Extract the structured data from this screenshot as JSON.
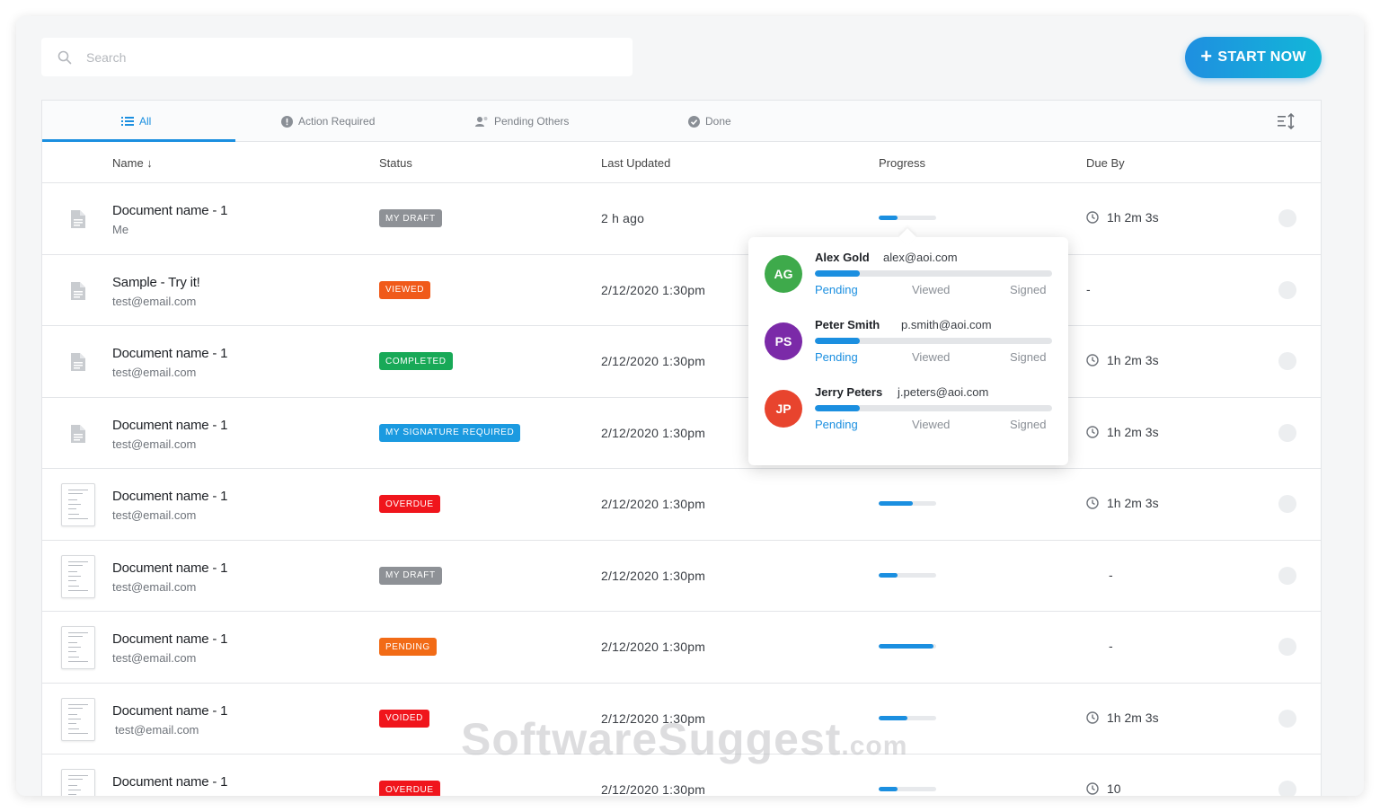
{
  "search": {
    "placeholder": "Search"
  },
  "start_button": {
    "label": "START NOW"
  },
  "tabs": [
    {
      "label": "All",
      "icon": "list-icon"
    },
    {
      "label": "Action Required",
      "icon": "alert-icon"
    },
    {
      "label": "Pending Others",
      "icon": "user-pending-icon"
    },
    {
      "label": "Done",
      "icon": "check-circle-icon"
    }
  ],
  "columns": {
    "name": "Name ↓",
    "status": "Status",
    "last_updated": "Last Updated",
    "progress": "Progress",
    "due_by": "Due By"
  },
  "rows": [
    {
      "title": "Document name - 1",
      "owner": "Me",
      "status": "MY DRAFT",
      "status_color": "#8e9196",
      "updated": "2 h ago",
      "progress": 0.33,
      "due": "1h 2m 3s"
    },
    {
      "title": "Sample - Try it!",
      "owner": "test@email.com",
      "status": "VIEWED",
      "status_color": "#f05a1a",
      "updated": "2/12/2020  1:30pm",
      "progress": 0.4,
      "due": "-"
    },
    {
      "title": "Document name - 1",
      "owner": "test@email.com",
      "status": "COMPLETED",
      "status_color": "#18a957",
      "updated": "2/12/2020  1:30pm",
      "progress": 1.0,
      "due": "1h 2m 3s"
    },
    {
      "title": "Document name - 1",
      "owner": "test@email.com",
      "status": "MY SIGNATURE REQUIRED",
      "status_color": "#1b9ae0",
      "updated": "2/12/2020  1:30pm",
      "progress": 0.5,
      "due": "1h 2m 3s"
    },
    {
      "title": "Document name - 1",
      "owner": "test@email.com",
      "status": "OVERDUE",
      "status_color": "#f0151c",
      "updated": "2/12/2020  1:30pm",
      "progress": 0.6,
      "due": "1h 2m 3s"
    },
    {
      "title": "Document name - 1",
      "owner": "test@email.com",
      "status": "MY DRAFT",
      "status_color": "#8e9196",
      "updated": "2/12/2020  1:30pm",
      "progress": 0.33,
      "due": "-"
    },
    {
      "title": "Document name - 1",
      "owner": "test@email.com",
      "status": "PENDING",
      "status_color": "#f26b16",
      "updated": "2/12/2020  1:30pm",
      "progress": 0.95,
      "due": "-"
    },
    {
      "title": "Document name - 1",
      "owner": "test@email.com",
      "status": "VOIDED",
      "status_color": "#f0151c",
      "updated": "2/12/2020  1:30pm",
      "progress": 0.5,
      "due": "1h 2m 3s"
    },
    {
      "title": "Document name - 1",
      "owner": "",
      "status": "OVERDUE",
      "status_color": "#f0151c",
      "updated": "2/12/2020  1:30pm",
      "progress": 0.33,
      "due": "10"
    }
  ],
  "popover": {
    "signers": [
      {
        "initials": "AG",
        "name": "Alex Gold",
        "email": "alex@aoi.com",
        "color": "#3eaa4b",
        "progress": 0.19
      },
      {
        "initials": "PS",
        "name": "Peter Smith",
        "email": "p.smith@aoi.com",
        "color": "#7b2aa8",
        "progress": 0.19
      },
      {
        "initials": "JP",
        "name": "Jerry Peters",
        "email": "j.peters@aoi.com",
        "color": "#e8442e",
        "progress": 0.19
      }
    ],
    "steps": [
      "Pending",
      "Viewed",
      "Signed"
    ]
  },
  "watermark": {
    "main": "SoftwareSuggest",
    "suffix": ".com"
  }
}
